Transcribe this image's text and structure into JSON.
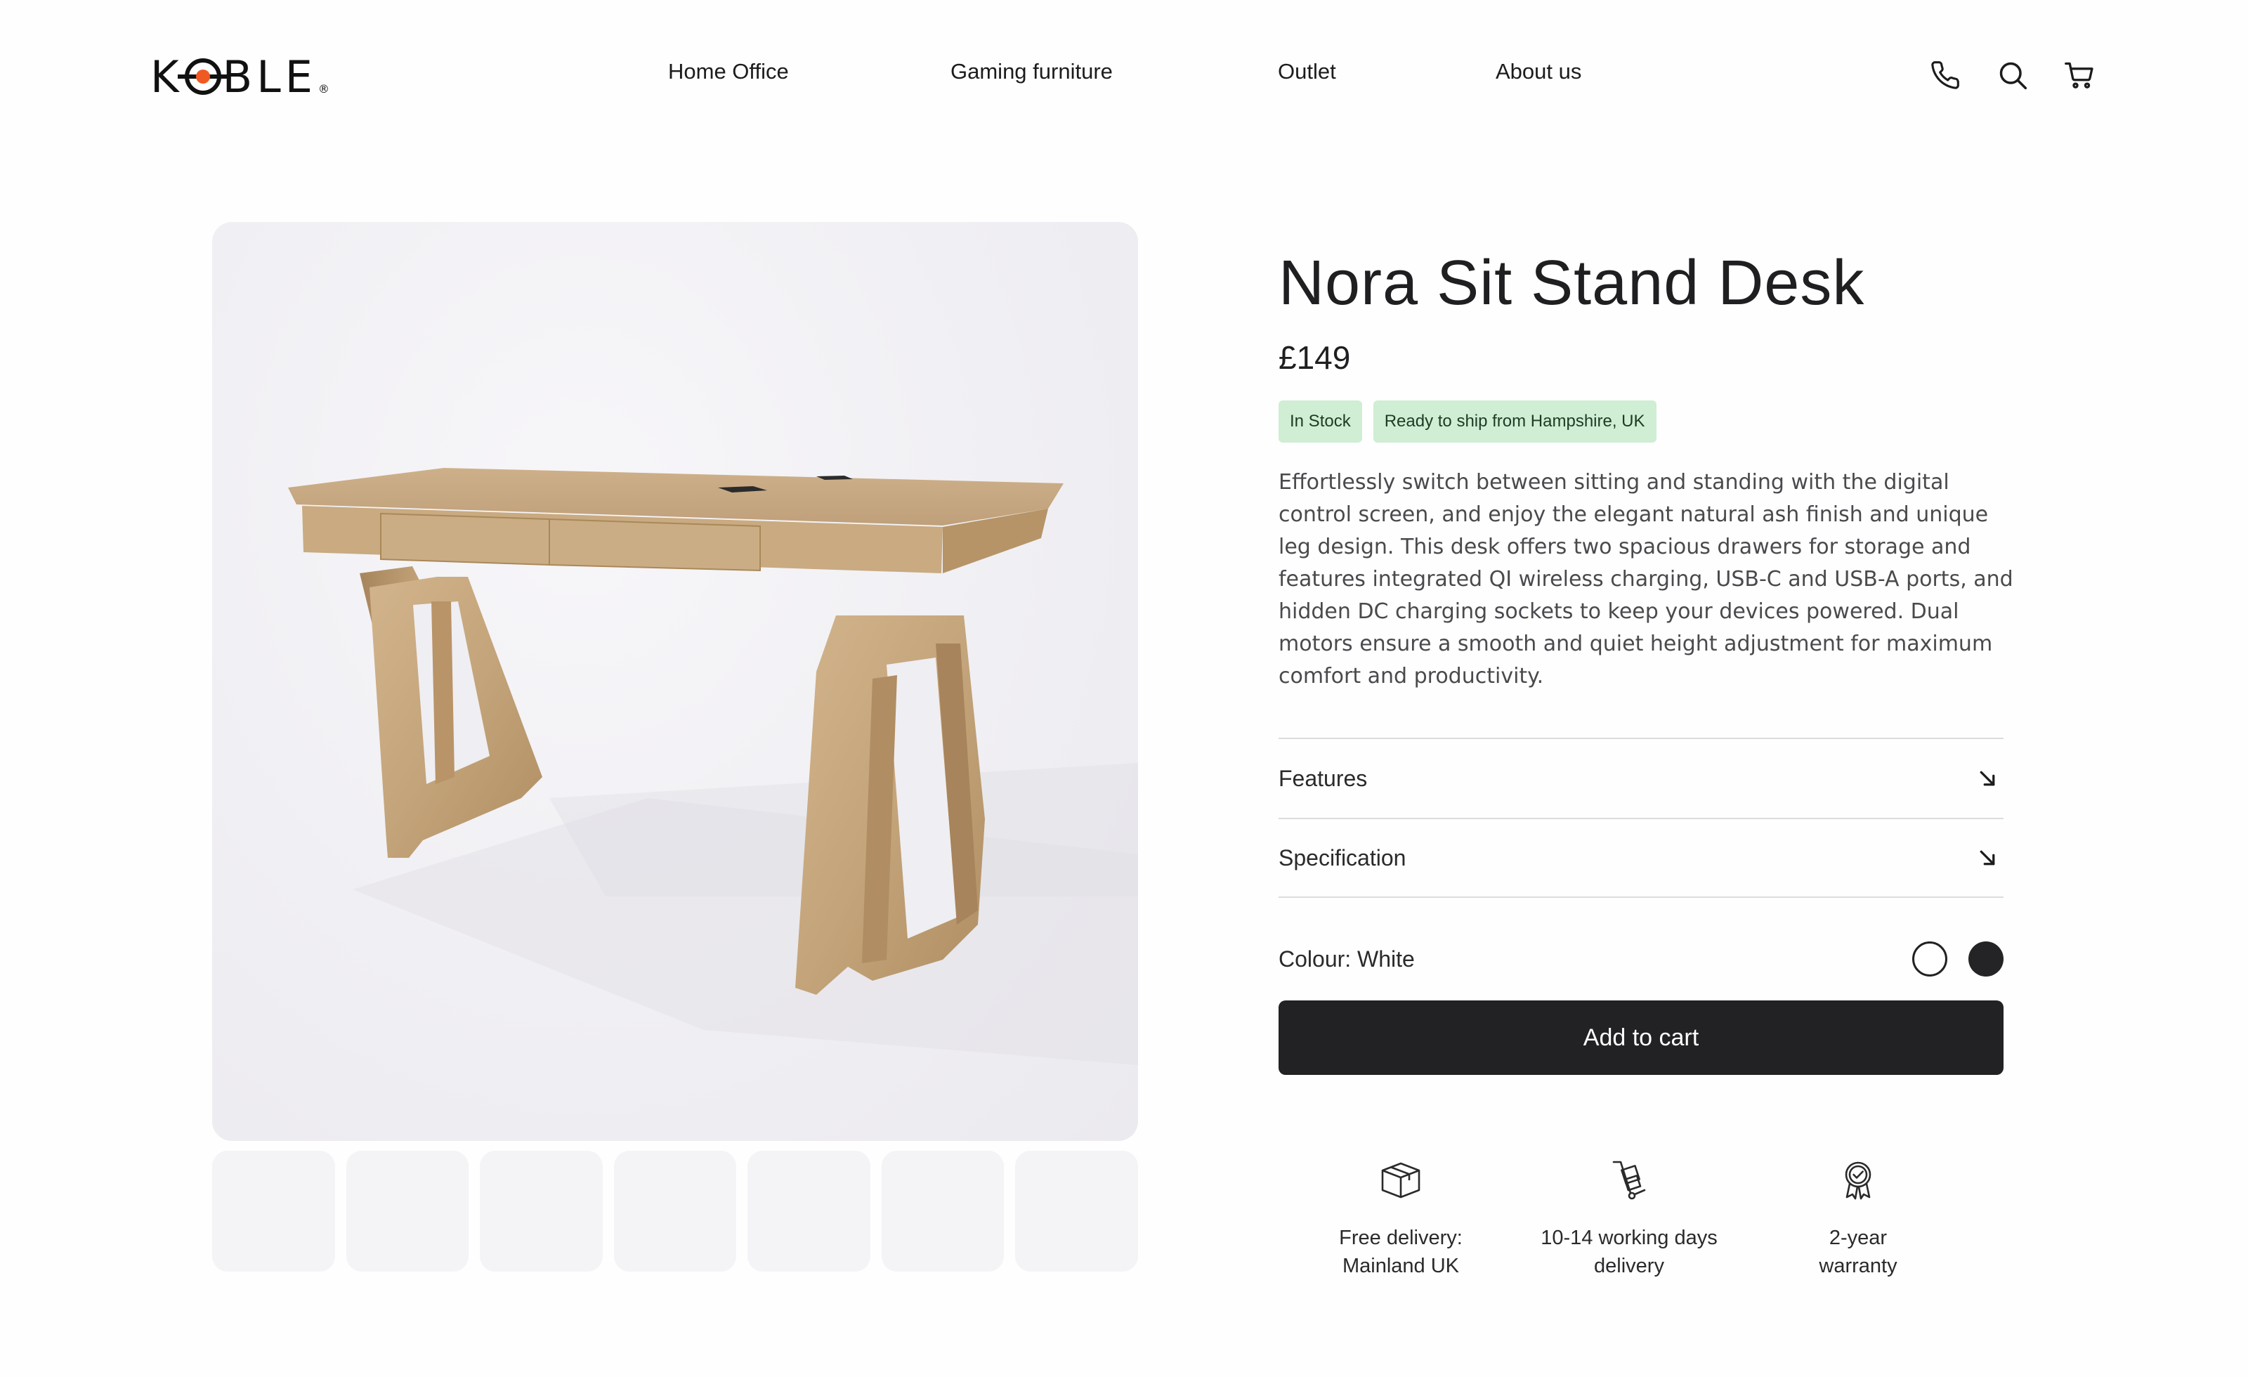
{
  "brand": {
    "logo_text_left": "K",
    "logo_text_right": "BLE",
    "logo_mark": "target-logo-mark",
    "accent": "#f05a22"
  },
  "nav": {
    "items": [
      {
        "label": "Home Office"
      },
      {
        "label": "Gaming furniture"
      },
      {
        "label": "Outlet"
      },
      {
        "label": "About us"
      }
    ]
  },
  "header_icons": [
    "phone-icon",
    "search-icon",
    "cart-icon"
  ],
  "gallery": {
    "main_image": "wooden-sit-stand-desk",
    "thumbnail_count": 7
  },
  "product": {
    "title": "Nora Sit Stand Desk",
    "price": "£149",
    "badges": [
      "In Stock",
      "Ready to ship from Hampshire, UK"
    ],
    "description": "Effortlessly switch between sitting and standing with the digital control screen, and enjoy the elegant natural ash finish and unique leg design. This desk offers two spacious drawers for storage and features integrated QI wireless charging, USB-C and USB-A ports, and hidden DC charging sockets to keep your devices powered. Dual motors ensure a smooth and quiet height adjustment for maximum comfort and productivity.",
    "accordions": [
      {
        "label": "Features"
      },
      {
        "label": "Specification"
      }
    ],
    "colour_label": "Colour: White",
    "colours": [
      {
        "name": "White",
        "hex": "#ffffff",
        "selected": true
      },
      {
        "name": "Black",
        "hex": "#242426",
        "selected": false
      }
    ],
    "add_to_cart": "Add to cart"
  },
  "perks": [
    {
      "icon": "box-icon",
      "line1": "Free delivery:",
      "line2": "Mainland UK"
    },
    {
      "icon": "hand-truck-icon",
      "line1": "10-14 working days",
      "line2": "delivery"
    },
    {
      "icon": "award-ribbon-icon",
      "line1": "2-year",
      "line2": "warranty"
    }
  ],
  "colors": {
    "badge_bg": "#cfeed4",
    "button_bg": "#222224",
    "image_bg": "#f0eff3"
  }
}
